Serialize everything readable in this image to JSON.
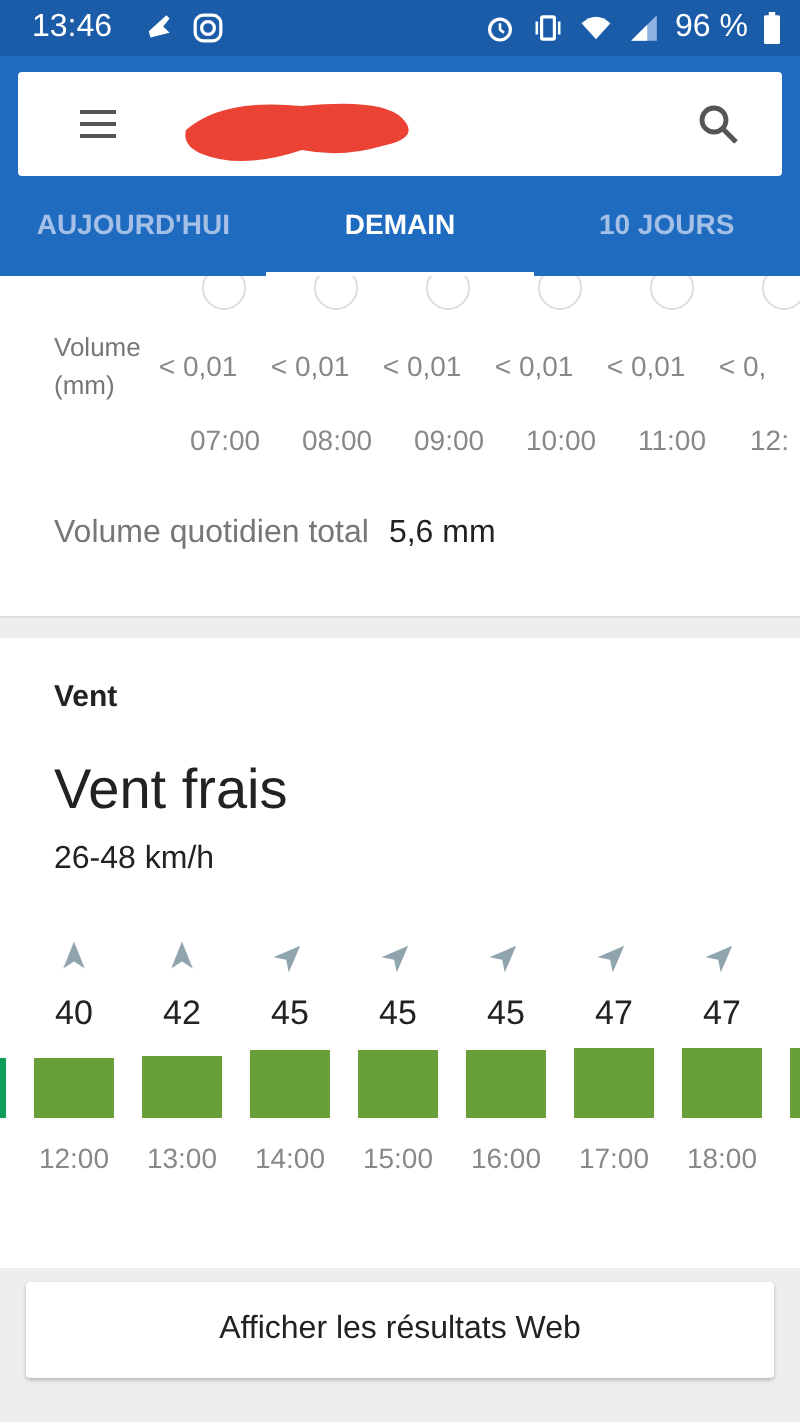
{
  "status_bar": {
    "time": "13:46",
    "battery": "96 %"
  },
  "tabs": [
    {
      "label": "AUJOURD'HUI",
      "selected": false
    },
    {
      "label": "DEMAIN",
      "selected": true
    },
    {
      "label": "10 JOURS",
      "selected": false
    }
  ],
  "rain": {
    "row_label": "Volume (mm)",
    "hours": [
      {
        "volume": "< 0,01",
        "time": "07:00"
      },
      {
        "volume": "< 0,01",
        "time": "08:00"
      },
      {
        "volume": "< 0,01",
        "time": "09:00"
      },
      {
        "volume": "< 0,01",
        "time": "10:00"
      },
      {
        "volume": "< 0,01",
        "time": "11:00"
      },
      {
        "volume": "< 0,",
        "time": "12:"
      }
    ],
    "total_label": "Volume quotidien total",
    "total_value": "5,6 mm"
  },
  "wind": {
    "title": "Vent",
    "summary": "Vent frais",
    "range": "26-48 km/h",
    "edge_bars": [
      {
        "color": "#0f9d58"
      },
      {
        "color": "#689f38"
      }
    ],
    "hours": [
      {
        "kind": "n",
        "speed": "40",
        "time": "12:00"
      },
      {
        "kind": "n",
        "speed": "42",
        "time": "13:00"
      },
      {
        "kind": "ne",
        "speed": "45",
        "time": "14:00"
      },
      {
        "kind": "ne",
        "speed": "45",
        "time": "15:00"
      },
      {
        "kind": "ne",
        "speed": "45",
        "time": "16:00"
      },
      {
        "kind": "ne",
        "speed": "47",
        "time": "17:00"
      },
      {
        "kind": "ne",
        "speed": "47",
        "time": "18:00"
      }
    ]
  },
  "web_button": "Afficher les résultats Web"
}
